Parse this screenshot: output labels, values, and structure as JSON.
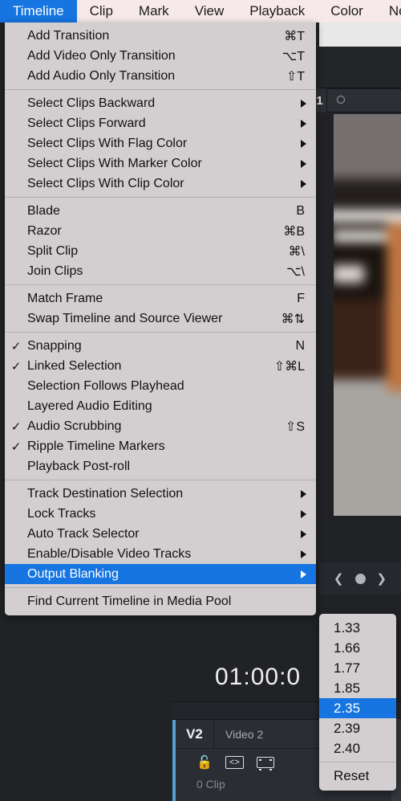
{
  "menubar": {
    "items": [
      {
        "label": "Timeline",
        "active": true
      },
      {
        "label": "Clip",
        "active": false
      },
      {
        "label": "Mark",
        "active": false
      },
      {
        "label": "View",
        "active": false
      },
      {
        "label": "Playback",
        "active": false
      },
      {
        "label": "Color",
        "active": false
      },
      {
        "label": "No",
        "active": false
      }
    ]
  },
  "timeline_menu": {
    "groups": [
      {
        "items": [
          {
            "label": "Add Transition",
            "shortcut": "⌘T",
            "checked": false,
            "submenu": false,
            "selected": false
          },
          {
            "label": "Add Video Only Transition",
            "shortcut": "⌥T",
            "checked": false,
            "submenu": false,
            "selected": false
          },
          {
            "label": "Add Audio Only Transition",
            "shortcut": "⇧T",
            "checked": false,
            "submenu": false,
            "selected": false
          }
        ]
      },
      {
        "items": [
          {
            "label": "Select Clips Backward",
            "shortcut": "",
            "checked": false,
            "submenu": true,
            "selected": false
          },
          {
            "label": "Select Clips Forward",
            "shortcut": "",
            "checked": false,
            "submenu": true,
            "selected": false
          },
          {
            "label": "Select Clips With Flag Color",
            "shortcut": "",
            "checked": false,
            "submenu": true,
            "selected": false
          },
          {
            "label": "Select Clips With Marker Color",
            "shortcut": "",
            "checked": false,
            "submenu": true,
            "selected": false
          },
          {
            "label": "Select Clips With Clip Color",
            "shortcut": "",
            "checked": false,
            "submenu": true,
            "selected": false
          }
        ]
      },
      {
        "items": [
          {
            "label": "Blade",
            "shortcut": "B",
            "checked": false,
            "submenu": false,
            "selected": false
          },
          {
            "label": "Razor",
            "shortcut": "⌘B",
            "checked": false,
            "submenu": false,
            "selected": false
          },
          {
            "label": "Split Clip",
            "shortcut": "⌘\\",
            "checked": false,
            "submenu": false,
            "selected": false
          },
          {
            "label": "Join Clips",
            "shortcut": "⌥\\",
            "checked": false,
            "submenu": false,
            "selected": false
          }
        ]
      },
      {
        "items": [
          {
            "label": "Match Frame",
            "shortcut": "F",
            "checked": false,
            "submenu": false,
            "selected": false
          },
          {
            "label": "Swap Timeline and Source Viewer",
            "shortcut": "⌘⇅",
            "checked": false,
            "submenu": false,
            "selected": false
          }
        ]
      },
      {
        "items": [
          {
            "label": "Snapping",
            "shortcut": "N",
            "checked": true,
            "submenu": false,
            "selected": false
          },
          {
            "label": "Linked Selection",
            "shortcut": "⇧⌘L",
            "checked": true,
            "submenu": false,
            "selected": false
          },
          {
            "label": "Selection Follows Playhead",
            "shortcut": "",
            "checked": false,
            "submenu": false,
            "selected": false
          },
          {
            "label": "Layered Audio Editing",
            "shortcut": "",
            "checked": false,
            "submenu": false,
            "selected": false
          },
          {
            "label": "Audio Scrubbing",
            "shortcut": "⇧S",
            "checked": true,
            "submenu": false,
            "selected": false
          },
          {
            "label": "Ripple Timeline Markers",
            "shortcut": "",
            "checked": true,
            "submenu": false,
            "selected": false
          },
          {
            "label": "Playback Post-roll",
            "shortcut": "",
            "checked": false,
            "submenu": false,
            "selected": false
          }
        ]
      },
      {
        "items": [
          {
            "label": "Track Destination Selection",
            "shortcut": "",
            "checked": false,
            "submenu": true,
            "selected": false
          },
          {
            "label": "Lock Tracks",
            "shortcut": "",
            "checked": false,
            "submenu": true,
            "selected": false
          },
          {
            "label": "Auto Track Selector",
            "shortcut": "",
            "checked": false,
            "submenu": true,
            "selected": false
          },
          {
            "label": "Enable/Disable Video Tracks",
            "shortcut": "",
            "checked": false,
            "submenu": true,
            "selected": false
          },
          {
            "label": "Output Blanking",
            "shortcut": "",
            "checked": false,
            "submenu": true,
            "selected": true
          }
        ]
      },
      {
        "items": [
          {
            "label": "Find Current Timeline in Media Pool",
            "shortcut": "",
            "checked": false,
            "submenu": false,
            "selected": false
          }
        ]
      }
    ]
  },
  "blanking_submenu": {
    "groups": [
      {
        "items": [
          {
            "label": "1.33",
            "selected": false
          },
          {
            "label": "1.66",
            "selected": false
          },
          {
            "label": "1.77",
            "selected": false
          },
          {
            "label": "1.85",
            "selected": false
          },
          {
            "label": "2.35",
            "selected": true
          },
          {
            "label": "2.39",
            "selected": false
          },
          {
            "label": "2.40",
            "selected": false
          }
        ]
      },
      {
        "items": [
          {
            "label": "Reset",
            "selected": false
          }
        ]
      }
    ]
  },
  "app_background": {
    "viewer_tab_number": "1",
    "timecode": "01:00:0",
    "track": {
      "id": "V2",
      "name": "Video 2",
      "clip_count": "0 Clip"
    }
  },
  "colors": {
    "accent_blue": "#1675e0",
    "menu_bg": "#d3cfd0",
    "menubar_bg": "#f7e9ea",
    "app_bg": "#202226",
    "track_accent": "#5a9fd4"
  }
}
